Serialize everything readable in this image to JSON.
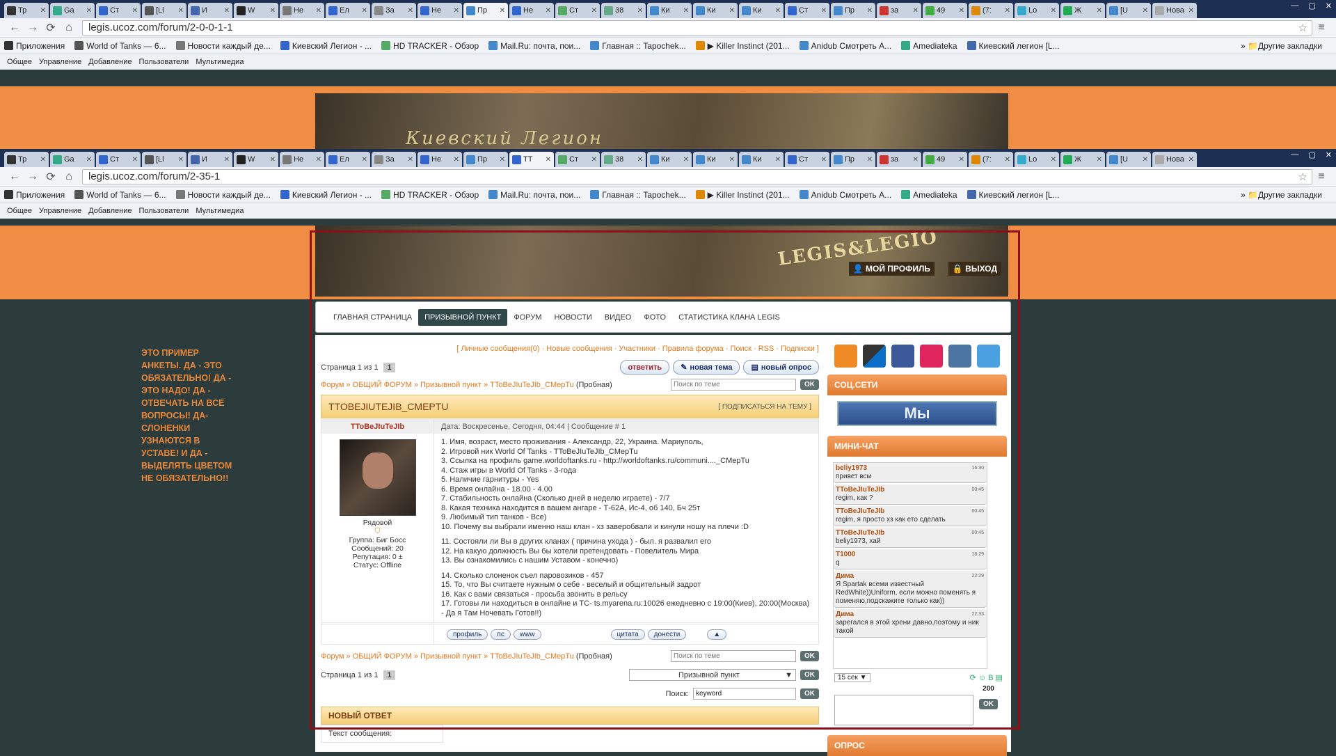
{
  "browser": {
    "tabs_top": [
      "Тр",
      "Ga",
      "Ст",
      "[Ll",
      "И",
      "W",
      "Не",
      "Ел",
      "За",
      "Не",
      "Пр",
      "Не",
      "Ст",
      "38",
      "Ки",
      "Ки",
      "Ки",
      "Ст",
      "Пр",
      "за",
      "49",
      "(7:",
      "Lo",
      "Ж",
      "[U",
      "Нова"
    ],
    "tabs_bottom": [
      "Тр",
      "Ga",
      "Ст",
      "[Ll",
      "И",
      "W",
      "Не",
      "Ел",
      "За",
      "Не",
      "Пр",
      "TT",
      "Ст",
      "38",
      "Ки",
      "Ки",
      "Ки",
      "Ст",
      "Пр",
      "за",
      "49",
      "(7:",
      "Lo",
      "Ж",
      "[U",
      "Нова"
    ],
    "url_top": "legis.ucoz.com/forum/2-0-0-1-1",
    "url_bottom": "legis.ucoz.com/forum/2-35-1",
    "bookmarks": [
      "Приложения",
      "World of Tanks — 6...",
      "Новости каждый де...",
      "Киевский Легион - ...",
      "HD TRACKER - Обзор",
      "Mail.Ru: почта, пои...",
      "Главная :: Tapochek...",
      "▶ Killer Instinct (201...",
      "Anidub Смотреть А...",
      "Amediateka",
      "Киевский легион [L..."
    ],
    "other_bookmarks": "Другие закладки",
    "ucoz_menu": [
      "Общее",
      "Управление",
      "Добавление",
      "Пользователи",
      "Мультимедиа"
    ]
  },
  "banner": {
    "title_top": "Киевский Легион",
    "logo": "LEGIS&LEGIO",
    "profile": "МОЙ ПРОФИЛЬ",
    "logout": "ВЫХОД"
  },
  "nav": [
    "ГЛАВНАЯ СТРАНИЦА",
    "ПРИЗЫВНОЙ ПУНКТ",
    "ФОРУМ",
    "НОВОСТИ",
    "ВИДЕО",
    "ФОТО",
    "СТАТИСТИКА КЛАНА LEGIS"
  ],
  "side_note": "ЭТО ПРИМЕР АНКЕТЫ. ДА - ЭТО ОБЯЗАТЕЛЬНО! ДА - ЭТО НАДО! ДА - ОТВЕЧАТЬ НА ВСЕ ВОПРОСЫ! ДА- СЛОНЕНКИ УЗНАЮТСЯ В УСТАВЕ! И ДА - ВЫДЕЛЯТЬ ЦВЕТОМ НЕ ОБЯЗАТЕЛЬНО!!",
  "forum": {
    "top_links": "[ Личные сообщения(0) · Новые сообщения · Участники · Правила форума · Поиск · RSS · Подписки ]",
    "page": "Страница 1 из 1",
    "page_num": "1",
    "btn_reply": "ответить",
    "btn_new_topic": "новая тема",
    "btn_new_poll": "новый опрос",
    "crumb_forum": "Форум",
    "crumb_general": "ОБЩИЙ ФОРУМ",
    "crumb_section": "Призывной пункт",
    "crumb_topic": "TToBeJIuTeJIb_CMepTu",
    "crumb_tag": "(Пробная)",
    "search_placeholder": "Поиск по теме",
    "ok": "OK",
    "topic_title": "TTOBEJIUTEJIB_CMEPTU",
    "subscribe": "[ ПОДПИСАТЬСЯ НА ТЕМУ ]",
    "author": "TToBeJIuTeJIb",
    "rank": "Рядовой",
    "group": "Группа: Биг Босс",
    "messages": "Сообщений: 20",
    "reputation": "Репутация: 0 ±",
    "status": "Статус: Offline",
    "post_head": "Дата: Воскресенье, Сегодня, 04:44 | Сообщение # 1",
    "lines": [
      "1. Имя, возраст, место проживания - Александр, 22, Украина. Мариуполь,",
      "2. Игровой ник World Of Tanks - TToBeJIuTeJIb_CMepTu",
      "3. Ссылка на профиль game.worldoftanks.ru - http://worldoftanks.ru/communi...._CMepTu",
      "4. Стаж игры в World Of Tanks - 3-года",
      "5. Наличие гарнитуры - Yes",
      "6. Время онлайна - 18.00 - 4.00",
      "7. Стабильность онлайна (Сколько дней в неделю играете) - 7/7",
      "8. Какая техника находится в вашем ангаре - Т-62А, Ис-4, об 140, Бч 25т",
      "9. Любимый тип танков - Все)",
      "10. Почему вы выбрали именно наш клан - хз заверобвали и кинули ношу на плечи :D",
      "11. Состояли ли Вы в других кланах ( причина ухода ) - был. я развалил его",
      "12. На какую должность Вы бы хотели претендовать - Повелитель Мира",
      "13. Вы ознакомились с нашим Уставом - конечно)",
      "14. Сколько слоненок съел паровозиков - 457",
      "15. То, что Вы считаете нужным о себе - веселый и общительный задрот",
      "16. Как с вами связаться - просьба звонить в рельсу",
      "17. Готовы ли находиться в онлайне и TC- ts.myarena.ru:10026 ежедневно с 19:00(Киев), 20:00(Москва) - Да я Там Ночевать Готов!!)"
    ],
    "pbtn_profile": "профиль",
    "pbtn_pm": "пс",
    "pbtn_www": "www",
    "pbtn_quote": "цитата",
    "pbtn_report": "донести",
    "jump_select": "Призывной пункт",
    "search_label": "Поиск:",
    "search_value": "keyword",
    "new_reply": "НОВЫЙ ОТВЕТ",
    "msg_text": "Текст сообщения:"
  },
  "sidebar": {
    "soc_title": "СОЦ.СЕТИ",
    "we_button": "Мы",
    "chat_title": "МИНИ-ЧАТ",
    "poll_title": "ОПРОС",
    "chat": [
      {
        "name": "beliy1973",
        "time": "16:30",
        "text": "привет всм"
      },
      {
        "name": "TToBeJIuTeJIb",
        "time": "00:45",
        "text": "regim, как ?"
      },
      {
        "name": "TToBeJIuTeJIb",
        "time": "00:45",
        "text": "regim, я просто хз как ето сделать"
      },
      {
        "name": "TToBeJIuTeJIb",
        "time": "00:45",
        "text": "beliy1973, хай"
      },
      {
        "name": "T1000",
        "time": "18:29",
        "text": "q"
      },
      {
        "name": "Дима",
        "time": "22:29",
        "text": "Я Spartak всеми известный RedWhite))Uniform, если можно поменять я поменяю,подскажите только как))"
      },
      {
        "name": "Дима",
        "time": "22:33",
        "text": "зарегался в этой хрени давно,поэтому и ник такой"
      }
    ],
    "interval": "15 сек",
    "chars": "200",
    "ok": "OK"
  }
}
